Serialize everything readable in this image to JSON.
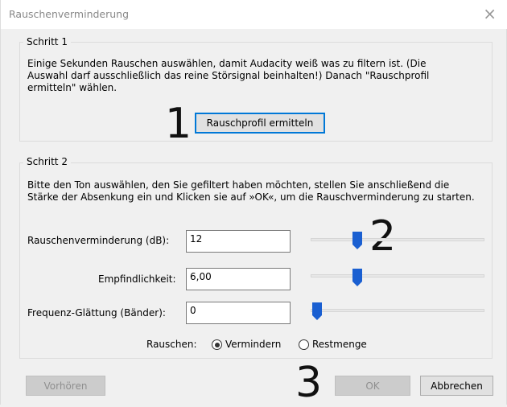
{
  "window": {
    "title": "Rauschenverminderung",
    "close_glyph": "×"
  },
  "step1": {
    "legend": "Schritt 1",
    "description_line1": "Einige Sekunden Rauschen auswählen, damit Audacity weiß was zu filtern ist. (Die",
    "description_line2": "Auswahl darf ausschließlich das reine Störsignal beinhalten!) Danach \"Rauschprofil",
    "description_line3": "ermitteln\" wählen.",
    "button_label": "Rauschprofil ermitteln",
    "annotation": "1"
  },
  "step2": {
    "legend": "Schritt 2",
    "description_line1": "Bitte den Ton auswählen, den Sie gefiltert haben möchten, stellen Sie anschließend die",
    "description_line2": "Stärke der Absenkung ein und Klicken sie auf »OK«, um die Rauschverminderung zu starten.",
    "annotation": "2",
    "fields": [
      {
        "label": "Rauschenverminderung (dB):",
        "value": "12",
        "slider_fraction": 0.24
      },
      {
        "label": "Empfindlichkeit:",
        "value": "6,00",
        "slider_fraction": 0.24
      },
      {
        "label": "Frequenz-Glättung (Bänder):",
        "value": "0",
        "slider_fraction": 0.0
      }
    ],
    "noise_label": "Rauschen:",
    "radio_options": [
      {
        "label": "Vermindern",
        "selected": true
      },
      {
        "label": "Restmenge",
        "selected": false
      }
    ]
  },
  "footer": {
    "preview_label": "Vorhören",
    "ok_label": "OK",
    "cancel_label": "Abbrechen",
    "annotation": "3"
  },
  "colors": {
    "accent": "#0078d7",
    "slider_thumb": "#1a5fd1"
  }
}
